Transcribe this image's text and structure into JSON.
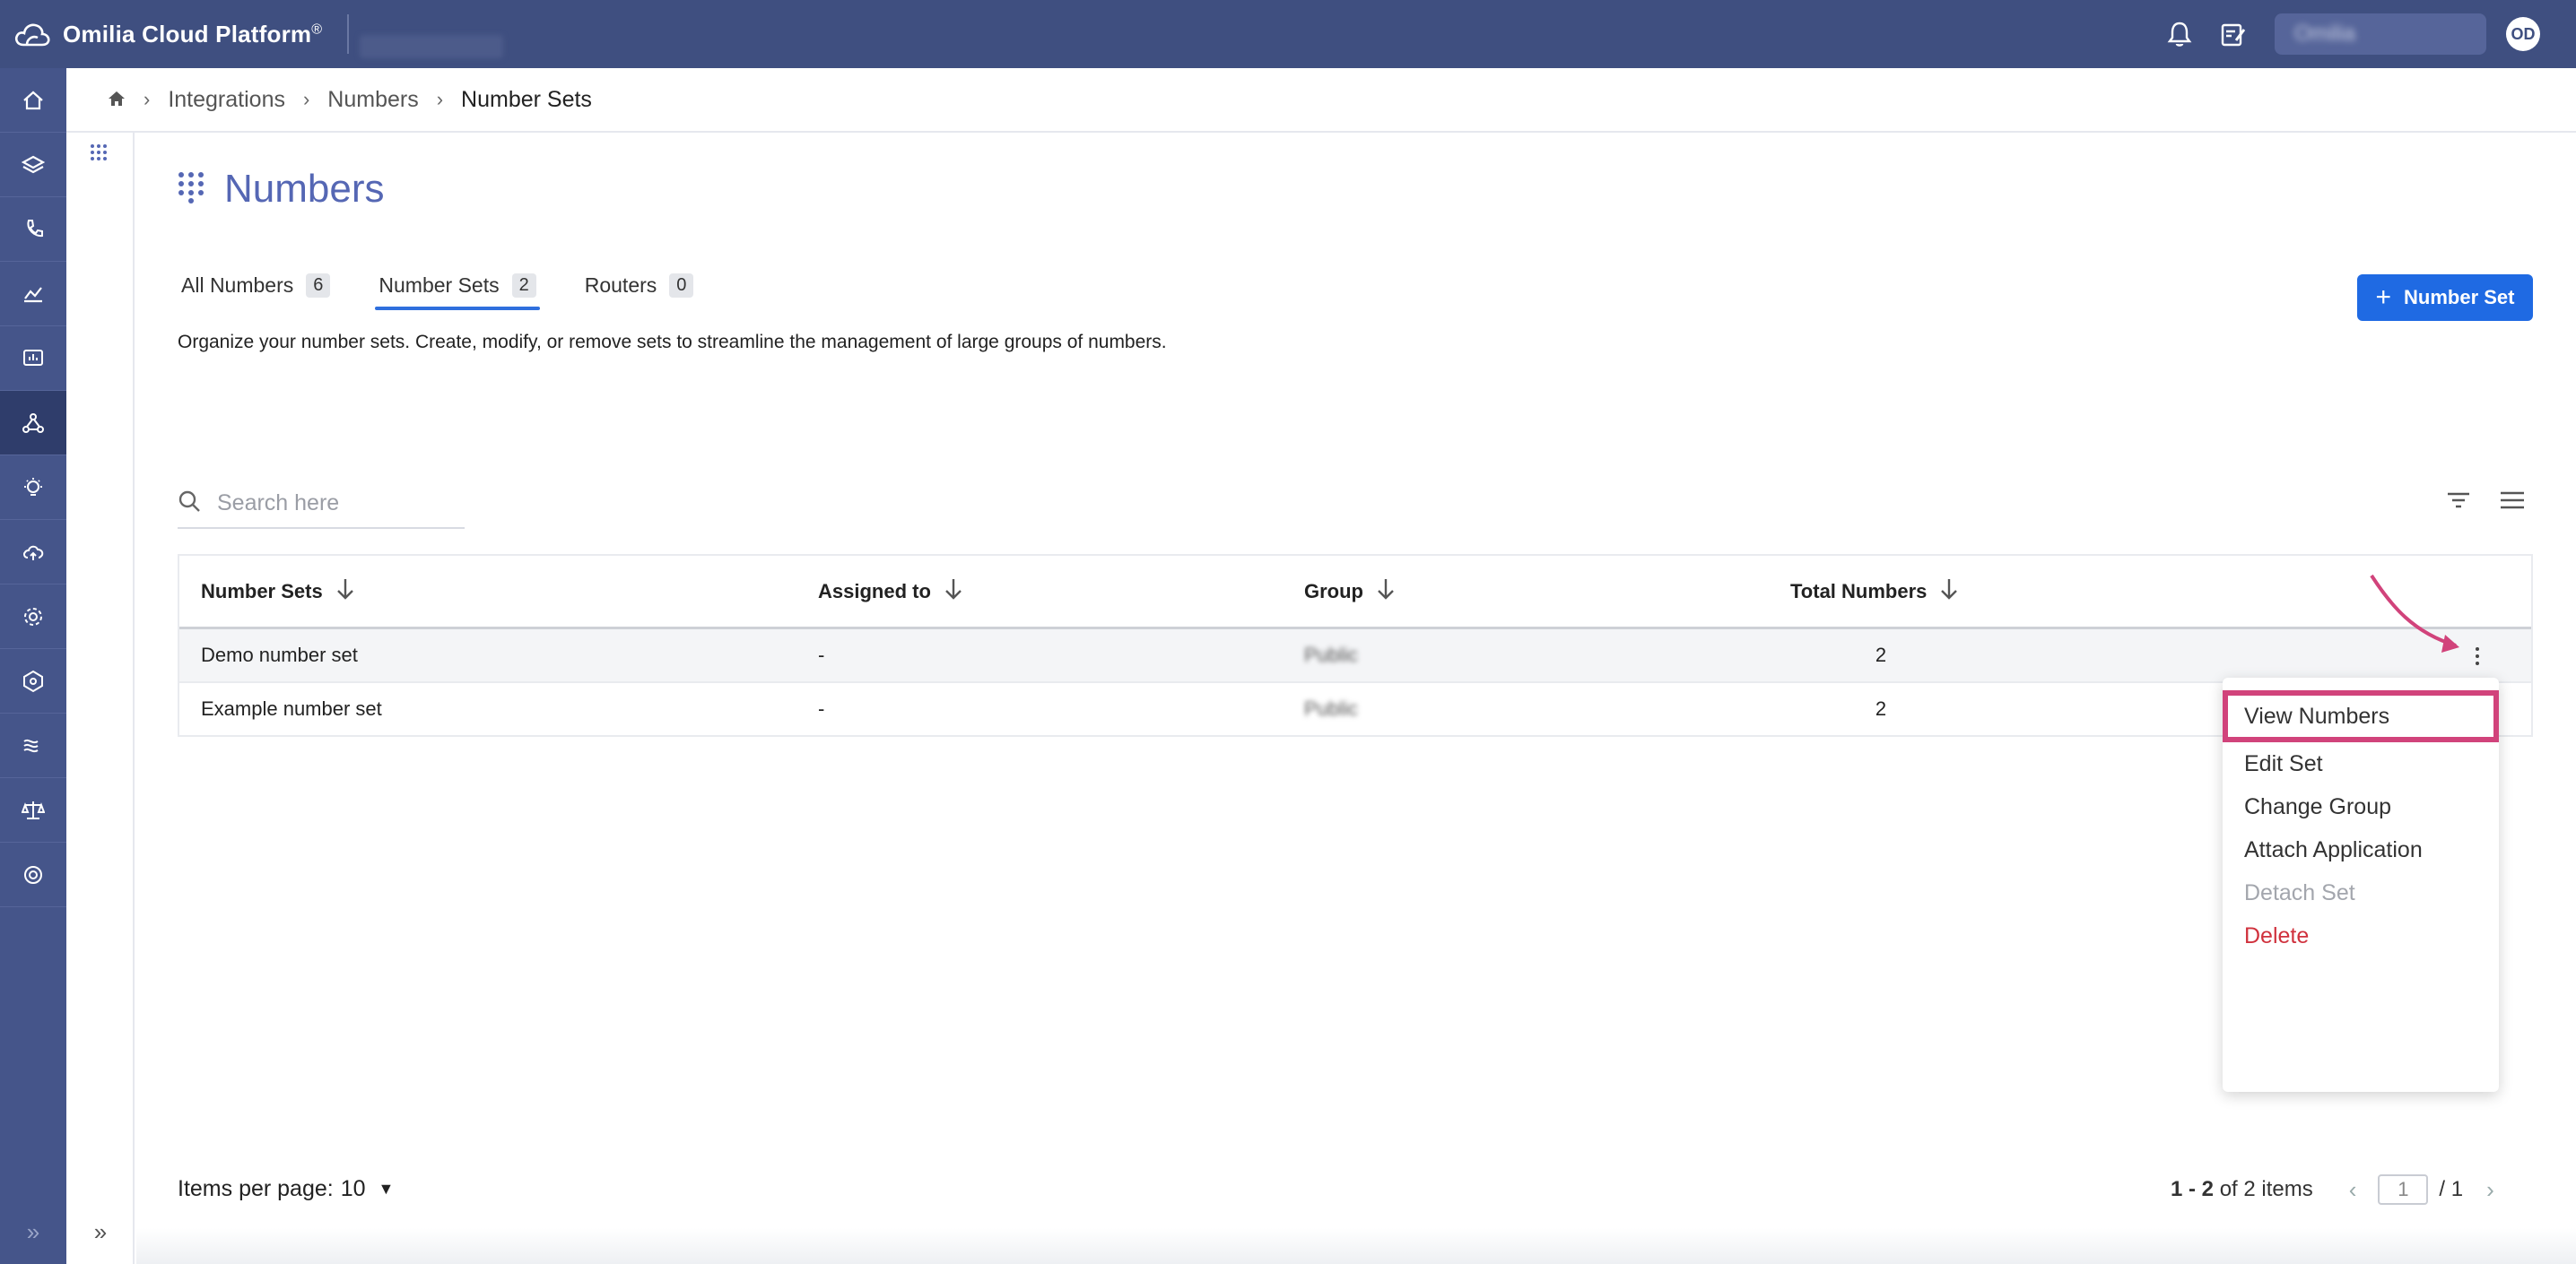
{
  "topbar": {
    "brand": "Omilia Cloud Platform",
    "brand_mark": "®",
    "user_name": "Omilia",
    "avatar_initials": "OD"
  },
  "breadcrumb": {
    "items": [
      "Integrations",
      "Numbers"
    ],
    "current": "Number Sets"
  },
  "page": {
    "title": "Numbers",
    "description": "Organize your number sets. Create, modify, or remove sets to streamline the management of large groups of numbers.",
    "add_button": "Number Set"
  },
  "tabs": [
    {
      "label": "All Numbers",
      "count": "6"
    },
    {
      "label": "Number Sets",
      "count": "2",
      "active": true
    },
    {
      "label": "Routers",
      "count": "0"
    }
  ],
  "search": {
    "placeholder": "Search here"
  },
  "table": {
    "headers": [
      "Number Sets",
      "Assigned to",
      "Group",
      "Total Numbers"
    ],
    "rows": [
      {
        "name": "Demo number set",
        "assigned": "-",
        "group": "Public",
        "total": "2"
      },
      {
        "name": "Example number set",
        "assigned": "-",
        "group": "Public",
        "total": "2"
      }
    ]
  },
  "menu": {
    "items": [
      "View Numbers",
      "Edit Set",
      "Change Group",
      "Attach Application",
      "Detach Set",
      "Delete"
    ]
  },
  "pagination": {
    "items_per_page_label": "Items per page:",
    "items_per_page": "10",
    "range": "1 - 2",
    "of_text": "of 2 items",
    "page": "1",
    "total_pages": "/ 1"
  },
  "colors": {
    "topbar": "#3f4f80",
    "accent": "#1f6ae3",
    "title": "#5567b4",
    "highlight": "#d1437b",
    "danger": "#d0313d"
  }
}
